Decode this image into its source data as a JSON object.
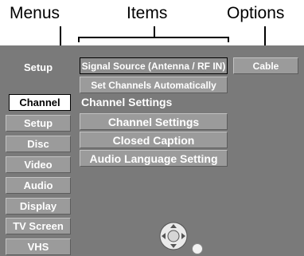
{
  "callouts": {
    "menus": "Menus",
    "items": "Items",
    "options": "Options"
  },
  "menu": {
    "header": "Setup",
    "items": [
      {
        "label": "Channel",
        "active": true
      },
      {
        "label": "Setup",
        "active": false
      },
      {
        "label": "Disc",
        "active": false
      },
      {
        "label": "Video",
        "active": false
      },
      {
        "label": "Audio",
        "active": false
      },
      {
        "label": "Display",
        "active": false
      },
      {
        "label": "TV Screen",
        "active": false
      },
      {
        "label": "VHS",
        "active": false
      }
    ]
  },
  "items": {
    "signal_source": "Signal Source (Antenna / RF IN)",
    "set_channels": "Set Channels Automatically",
    "section_label": "Channel Settings",
    "channel_settings": "Channel Settings",
    "closed_caption": "Closed Caption",
    "audio_language": "Audio Language Setting"
  },
  "options": {
    "signal_source_value": "Cable"
  },
  "icons": {
    "dpad": "directional-pad-icon",
    "indicator": "indicator-dot-icon"
  }
}
